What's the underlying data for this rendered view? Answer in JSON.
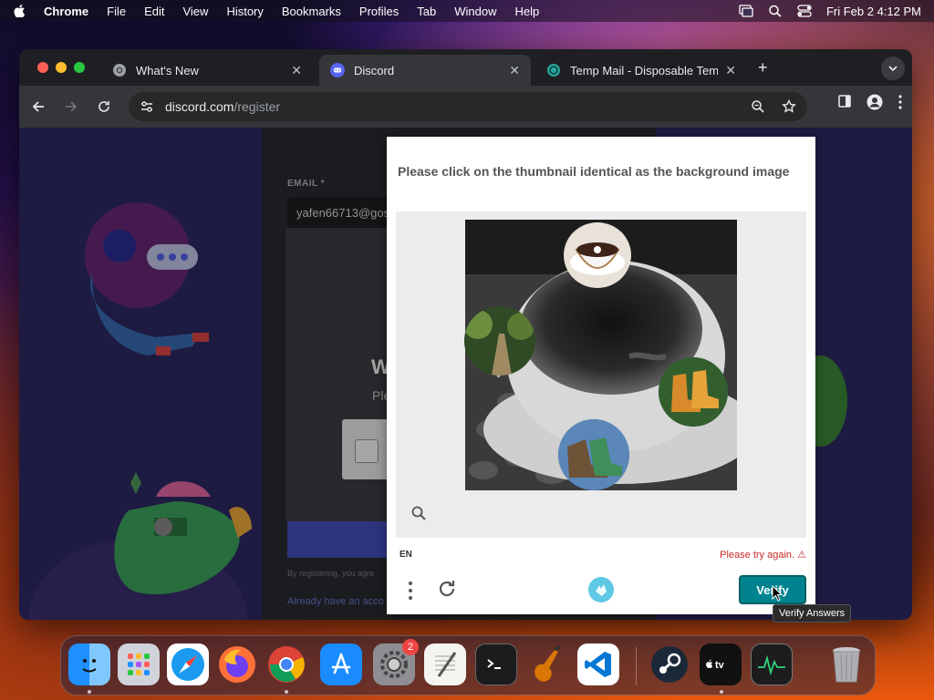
{
  "menubar": {
    "app": "Chrome",
    "items": [
      "File",
      "Edit",
      "View",
      "History",
      "Bookmarks",
      "Profiles",
      "Tab",
      "Window",
      "Help"
    ],
    "clock": "Fri Feb 2  4:12 PM"
  },
  "tabs": [
    {
      "title": "What's New",
      "favicon": "chrome-icon"
    },
    {
      "title": "Discord",
      "favicon": "discord-icon"
    },
    {
      "title": "Temp Mail - Disposable Temp",
      "favicon": "tempmail-icon"
    }
  ],
  "omnibox": {
    "domain": "discord.com",
    "path": "/register"
  },
  "register": {
    "email_label": "EMAIL *",
    "email_value": "yafen66713@gos",
    "modal_title": "W",
    "modal_text": "Ple",
    "fine_print": "By registering, you agre",
    "login_link": "Already have an acco"
  },
  "challenge": {
    "prompt": "Please click on the thumbnail identical as the background image",
    "language": "EN",
    "error": "Please try again. ⚠",
    "verify_label": "Verify",
    "tooltip": "Verify Answers"
  },
  "dock": {
    "notification_badge": "2",
    "apps": [
      "finder-icon",
      "launchpad-icon",
      "safari-icon",
      "firefox-icon",
      "chrome-icon",
      "app-store-icon",
      "system-settings-icon",
      "textedit-icon",
      "terminal-icon",
      "garageband-icon",
      "vscode-icon",
      "steam-icon",
      "apple-tv-icon",
      "activity-monitor-icon",
      "trash-icon"
    ]
  }
}
